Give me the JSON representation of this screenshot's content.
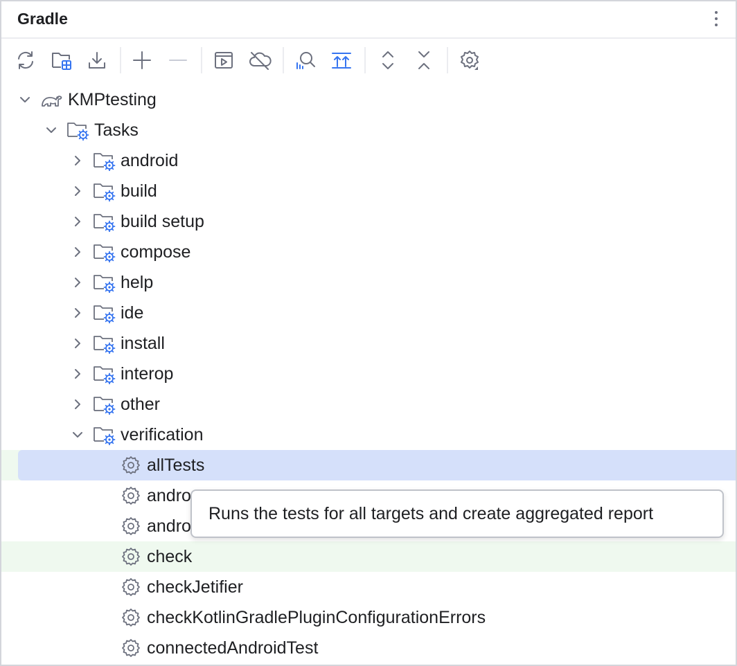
{
  "panel": {
    "title": "Gradle"
  },
  "toolbar": {
    "buttons": [
      {
        "name": "reload-icon"
      },
      {
        "name": "link-project-icon"
      },
      {
        "name": "download-sources-icon"
      },
      {
        "name": "add-icon"
      },
      {
        "name": "remove-icon"
      },
      {
        "name": "execute-task-icon"
      },
      {
        "name": "offline-mode-icon"
      },
      {
        "name": "analyze-dependencies-icon"
      },
      {
        "name": "show-dependencies-icon"
      },
      {
        "name": "expand-all-icon"
      },
      {
        "name": "collapse-all-icon"
      },
      {
        "name": "settings-icon"
      }
    ]
  },
  "tree": {
    "project": "KMPtesting",
    "tasks": "Tasks",
    "groups": [
      "android",
      "build",
      "build setup",
      "compose",
      "help",
      "ide",
      "install",
      "interop",
      "other"
    ],
    "verification": "verification",
    "verification_tasks": [
      "allTests",
      "andro",
      "andro",
      "check",
      "checkJetifier",
      "checkKotlinGradlePluginConfigurationErrors",
      "connectedAndroidTest"
    ]
  },
  "tooltip": {
    "text": "Runs the tests for all targets and create aggregated report"
  },
  "colors": {
    "accent": "#3574f0",
    "selection": "#d5e0fa",
    "highlight_band": "#eff9ef",
    "icon_gray": "#6c707e"
  }
}
